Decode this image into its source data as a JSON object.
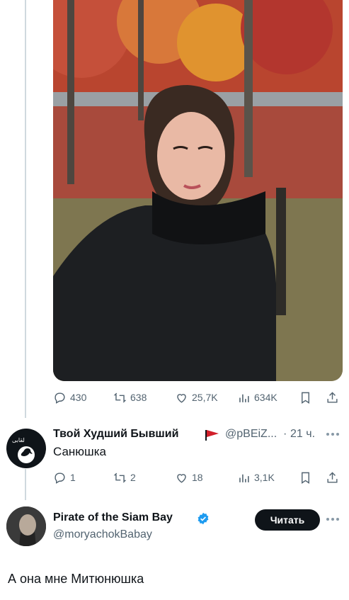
{
  "main_tweet": {
    "stats": {
      "replies": "430",
      "reposts": "638",
      "likes": "25,7K",
      "views": "634K"
    }
  },
  "reply": {
    "author_name": "Твой Худший Бывший",
    "handle": "@pBEiZ...",
    "separator": "·",
    "time": "21 ч.",
    "text": "Санюшка",
    "avatar_label": "لقابی",
    "stats": {
      "replies": "1",
      "reposts": "2",
      "likes": "18",
      "views": "3,1K"
    }
  },
  "profile": {
    "name": "Pirate of the Siam Bay",
    "handle": "@moryachokBabay",
    "follow_label": "Читать"
  },
  "caption": "А она мне Митюнюшка",
  "colors": {
    "verified": "#1d9bf0",
    "flag": "#d11f2a",
    "text_secondary": "#536471",
    "thread_line": "#cfd9de"
  }
}
